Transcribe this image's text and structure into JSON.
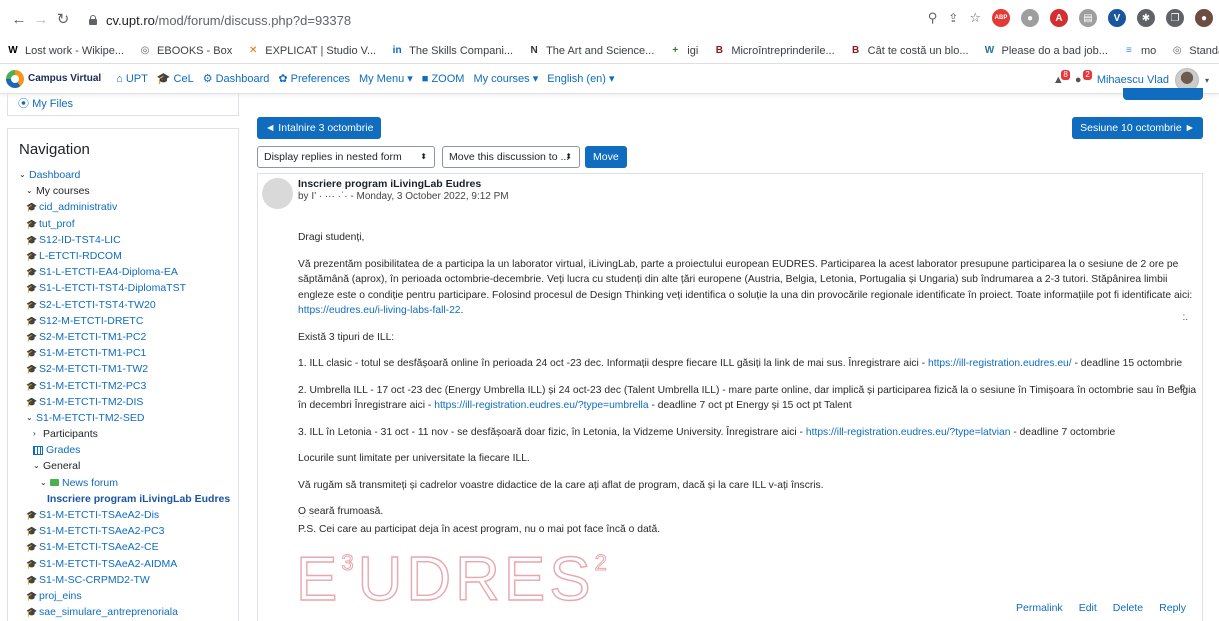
{
  "browser": {
    "url_host": "cv.upt.ro",
    "url_path": "/mod/forum/discuss.php?d=93378",
    "extensions": [
      {
        "name": "abp-icon",
        "label": "ABP",
        "color": "#e53935"
      },
      {
        "name": "record-icon",
        "label": "●",
        "color": "#9e9e9e"
      },
      {
        "name": "pdf-icon",
        "label": "A",
        "color": "#d32f2f"
      },
      {
        "name": "doc-icon",
        "label": "▤",
        "color": "#9e9e9e"
      },
      {
        "name": "vpn-icon",
        "label": "V",
        "color": "#1a55a0"
      },
      {
        "name": "puzzle-icon",
        "label": "✱",
        "color": "#5f6368"
      },
      {
        "name": "window-icon",
        "label": "❐",
        "color": "#5f6368"
      },
      {
        "name": "profile-icon",
        "label": "●",
        "color": "#6d4c41"
      }
    ]
  },
  "bookmarks": [
    {
      "name": "bookmark-wikipedia",
      "icon": "W",
      "label": "Lost work - Wikipe...",
      "color": "#000000"
    },
    {
      "name": "bookmark-ebooks",
      "icon": "◎",
      "label": "EBOOKS - Box",
      "color": "#5f6368"
    },
    {
      "name": "bookmark-explicat",
      "icon": "✕",
      "label": "EXPLICAT | Studio V...",
      "color": "#ef6c00"
    },
    {
      "name": "bookmark-skills",
      "icon": "in",
      "label": "The Skills Compani...",
      "color": "#0a66c2"
    },
    {
      "name": "bookmark-art",
      "icon": "N",
      "label": "The Art and Science...",
      "color": "#333333"
    },
    {
      "name": "bookmark-igi",
      "icon": "+",
      "label": "igi",
      "color": "#2e7d32"
    },
    {
      "name": "bookmark-microintre",
      "icon": "B",
      "label": "Microîntreprinderile...",
      "color": "#8b1a1a"
    },
    {
      "name": "bookmark-cat-costa",
      "icon": "B",
      "label": "Cât te costă un blo...",
      "color": "#8b1a1a"
    },
    {
      "name": "bookmark-please",
      "icon": "W",
      "label": "Please do a bad job...",
      "color": "#21759b"
    },
    {
      "name": "bookmark-mo",
      "icon": "≡",
      "label": "mo",
      "color": "#4285f4"
    },
    {
      "name": "bookmark-standardele",
      "icon": "◎",
      "label": "Standardele specific...",
      "color": "#5f6368"
    }
  ],
  "moodle_nav": {
    "logo": "Campus Virtual",
    "items": [
      {
        "name": "nav-upt",
        "glyph": "⌂",
        "label": "UPT"
      },
      {
        "name": "nav-cel",
        "glyph": "🎓",
        "label": "CeL"
      },
      {
        "name": "nav-dashboard",
        "glyph": "⚙",
        "label": "Dashboard"
      },
      {
        "name": "nav-preferences",
        "glyph": "✿",
        "label": "Preferences"
      },
      {
        "name": "nav-my-menu",
        "glyph": "",
        "label": "My Menu ▾"
      },
      {
        "name": "nav-zoom",
        "glyph": "■",
        "label": "ZOOM"
      },
      {
        "name": "nav-my-courses",
        "glyph": "",
        "label": "My courses ▾"
      },
      {
        "name": "nav-language",
        "glyph": "",
        "label": "English (en) ▾"
      }
    ],
    "notif_count": "8",
    "msg_count": "2",
    "user_name": "Mihaescu Vlad"
  },
  "left": {
    "my_files": "My Files",
    "nav_title": "Navigation",
    "tree": [
      {
        "label": "Dashboard",
        "type": "chev-open",
        "indent": 0
      },
      {
        "label": "My courses",
        "type": "chev-open-plain",
        "indent": 1
      },
      {
        "label": "cid_administrativ",
        "type": "course",
        "indent": 1
      },
      {
        "label": "tut_prof",
        "type": "course",
        "indent": 1
      },
      {
        "label": "S12-ID-TST4-LIC",
        "type": "course",
        "indent": 1
      },
      {
        "label": "L-ETCTI-RDCOM",
        "type": "course",
        "indent": 1
      },
      {
        "label": "S1-L-ETCTI-EA4-Diploma-EA",
        "type": "course",
        "indent": 1
      },
      {
        "label": "S1-L-ETCTI-TST4-DiplomaTST",
        "type": "course",
        "indent": 1
      },
      {
        "label": "S2-L-ETCTI-TST4-TW20",
        "type": "course",
        "indent": 1
      },
      {
        "label": "S12-M-ETCTI-DRETC",
        "type": "course",
        "indent": 1
      },
      {
        "label": "S2-M-ETCTI-TM1-PC2",
        "type": "course",
        "indent": 1
      },
      {
        "label": "S1-M-ETCTI-TM1-PC1",
        "type": "course",
        "indent": 1
      },
      {
        "label": "S2-M-ETCTI-TM1-TW2",
        "type": "course",
        "indent": 1
      },
      {
        "label": "S1-M-ETCTI-TM2-PC3",
        "type": "course",
        "indent": 1
      },
      {
        "label": "S1-M-ETCTI-TM2-DIS",
        "type": "course",
        "indent": 1
      },
      {
        "label": "S1-M-ETCTI-TM2-SED",
        "type": "chev-open",
        "indent": 1
      },
      {
        "label": "Participants",
        "type": "chev-closed-plain",
        "indent": 2
      },
      {
        "label": "Grades",
        "type": "grades",
        "indent": 2
      },
      {
        "label": "General",
        "type": "chev-open-plain",
        "indent": 2
      },
      {
        "label": "News forum",
        "type": "forum",
        "indent": 3
      },
      {
        "label": "Inscriere program iLivingLab Eudres",
        "type": "bold",
        "indent": 4
      },
      {
        "label": "S1-M-ETCTI-TSAeA2-Dis",
        "type": "course",
        "indent": 1
      },
      {
        "label": "S1-M-ETCTI-TSAeA2-PC3",
        "type": "course",
        "indent": 1
      },
      {
        "label": "S1-M-ETCTI-TSAeA2-CE",
        "type": "course",
        "indent": 1
      },
      {
        "label": "S1-M-ETCTI-TSAeA2-AIDMA",
        "type": "course",
        "indent": 1
      },
      {
        "label": "S1-M-SC-CRPMD2-TW",
        "type": "course",
        "indent": 1
      },
      {
        "label": "proj_eins",
        "type": "course",
        "indent": 1
      },
      {
        "label": "sae_simulare_antreprenoriala",
        "type": "course",
        "indent": 1
      }
    ]
  },
  "main": {
    "prev_label": "◄ Intalnire 3 octombrie",
    "next_label": "Sesiune 10 octombrie ►",
    "display_mode": "Display replies in nested form",
    "move_select": "Move this discussion to ...",
    "move_button": "Move",
    "post": {
      "subject": "Inscriere program iLivingLab Eudres",
      "by": "by I’ ·  ···  ·ˈ·  - Monday, 3 October 2022, 9:12 PM",
      "greeting": "Dragi studenți,",
      "para1": "Vă prezentăm posibilitatea de a participa la un laborator virtual, iLivingLab, parte a proiectului european EUDRES. Participarea la acest laborator presupune participarea la o sesiune de 2 ore pe săptămână (aprox), în perioada octombrie-decembrie. Veți lucra cu studenți din alte țări europene (Austria, Belgia, Letonia, Portugalia și Ungaria) sub îndrumarea a 2-3 tutori. Stăpânirea limbii engleze este o condiție pentru participare. Folosind procesul de Design Thinking veți identifica o soluție la una din provocările regionale identificate în proiect. Toate informațiile pot fi identificate aici:",
      "link1": "https://eudres.eu/i-living-labs-fall-22",
      "intro_types": "Există 3 tipuri de ILL:",
      "item1_a": "1. ILL clasic - totul se desfășoară online în perioada 24 oct -23 dec. Informații despre fiecare ILL găsiți la link de mai sus. Înregistrare aici -",
      "item1_link": "https://ill-registration.eudres.eu/",
      "item1_b": " - deadline 15 octombrie",
      "item2_a": "2. Umbrella ILL - 17 oct -23 dec (Energy Umbrella ILL) și 24 oct-23 dec (Talent Umbrella ILL) - mare parte online, dar implică și participarea fizică la o sesiune în Timișoara în octombrie sau în Belgia în decembri Înregistrare aici -",
      "item2_link": "https://ill-registration.eudres.eu/?type=umbrella",
      "item2_b": " - deadline 7 oct pt Energy și 15 oct pt Talent",
      "item3_a": "3. ILL în Letonia - 31 oct - 11 nov - se desfășoară doar fizic, în Letonia, la Vidzeme University. Înregistrare aici -",
      "item3_link": "https://ill-registration.eudres.eu/?type=latvian",
      "item3_b": " - deadline 7 octombrie",
      "places": "Locurile sunt limitate per universitate la fiecare ILL.",
      "ask": "Vă rugăm să transmiteți și cadrelor voastre didactice de la care ați aflat de program, dacă și la care ILL v-ați înscris.",
      "closing": "O seară frumoasă.",
      "ps": "P.S. Cei care au participat deja în acest program, nu o mai pot face încă o dată.",
      "logo_main": "EUDRES",
      "logo_sup3": "3",
      "logo_sup2": "2",
      "edge1": ":.",
      "edge2": "e.",
      "actions": [
        "Permalink",
        "Edit",
        "Delete",
        "Reply"
      ]
    }
  }
}
